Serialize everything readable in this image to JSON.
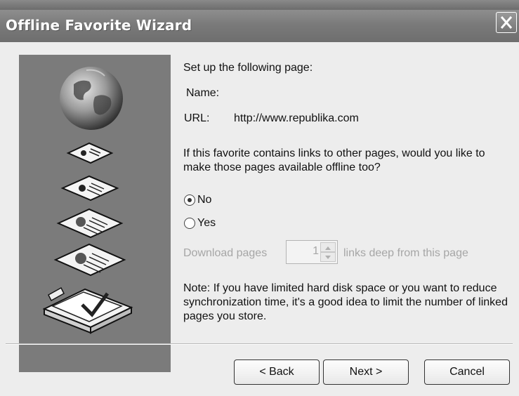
{
  "window": {
    "title": "Offline Favorite Wizard"
  },
  "icons": {
    "close": "close-icon",
    "globe": "globe-icon",
    "document": "document-icon"
  },
  "main": {
    "heading": "Set up the following page:",
    "name_label": "Name:",
    "url_label": "URL:",
    "url_value": "http://www.republika.com",
    "question": "If this favorite contains links to other pages, would you like to make those pages available offline too?",
    "options": [
      {
        "label": "No",
        "selected": true
      },
      {
        "label": "Yes",
        "selected": false
      }
    ],
    "download_prefix": "Download pages",
    "depth_value": "1",
    "download_suffix": "links deep from this page",
    "note": "Note: If you have limited hard disk space or you want to reduce synchronization time, it's a good idea to limit the number of linked pages you store."
  },
  "buttons": {
    "back": "< Back",
    "next": "Next >",
    "cancel": "Cancel"
  },
  "colors": {
    "titlebar": "#7a7a7a",
    "side_panel": "#7b7b7b",
    "window_bg": "#ededed"
  }
}
